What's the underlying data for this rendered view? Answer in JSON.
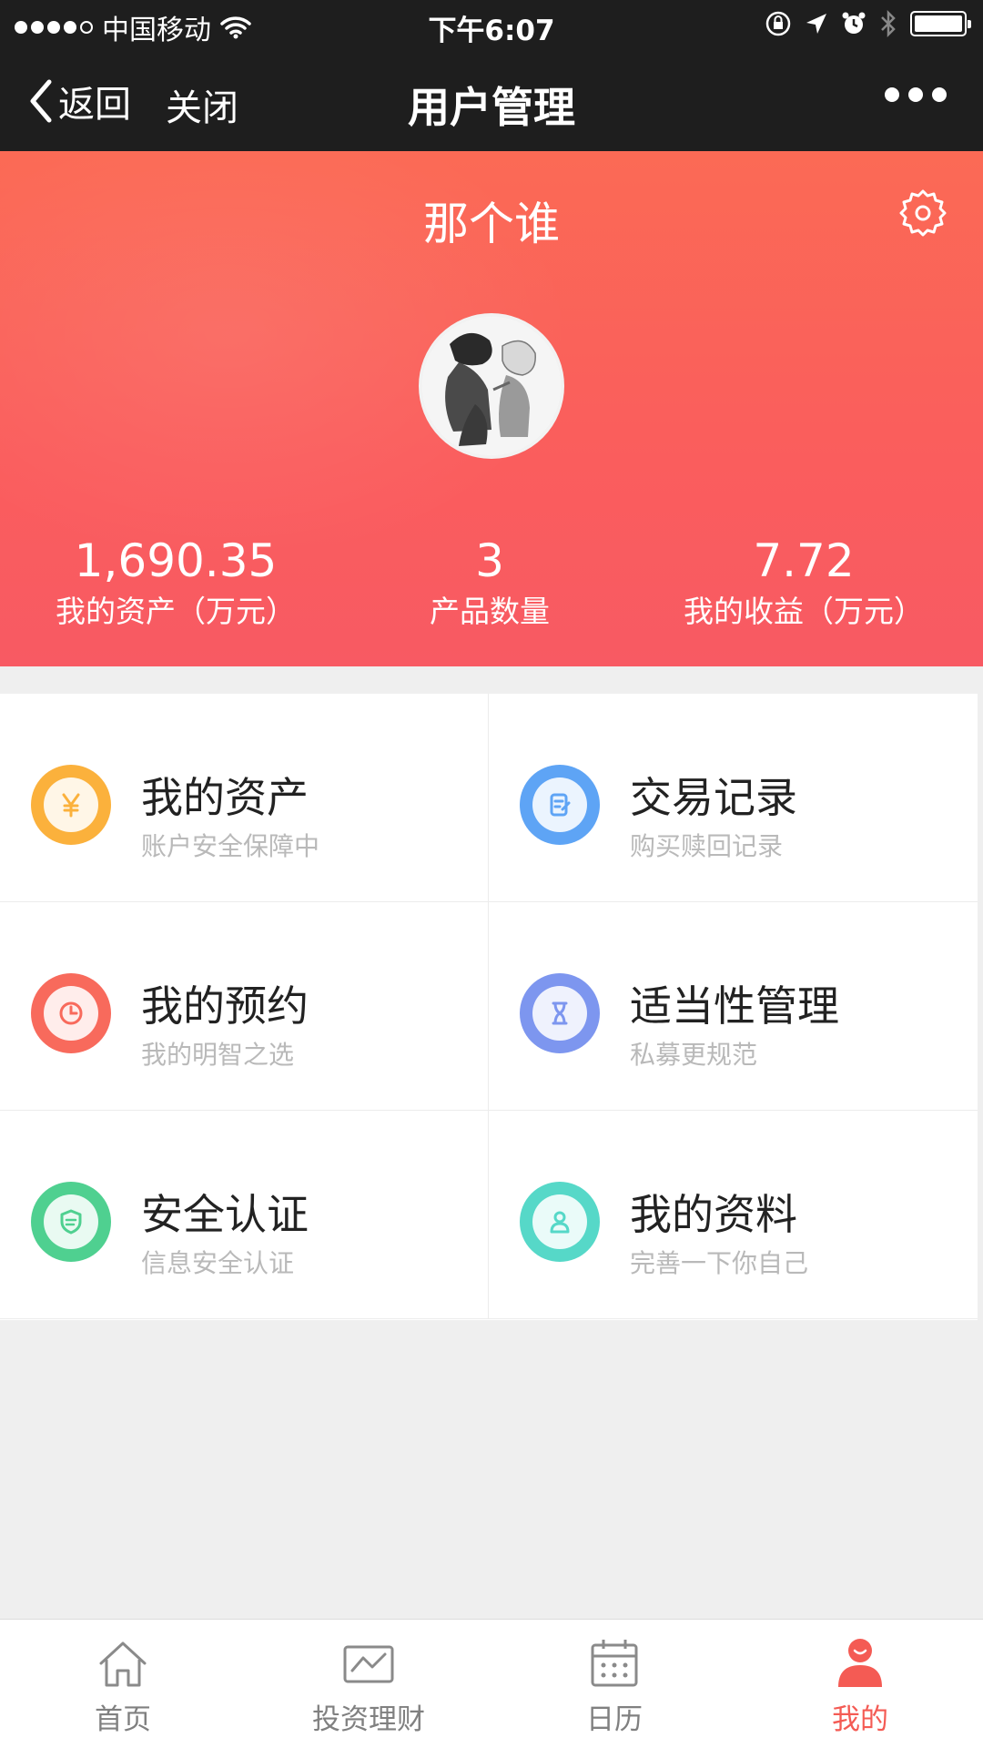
{
  "status_bar": {
    "carrier": "中国移动",
    "time": "下午6:07"
  },
  "nav": {
    "back_label": "返回",
    "close_label": "关闭",
    "title": "用户管理"
  },
  "profile": {
    "username": "那个谁",
    "stats": [
      {
        "value": "1,690.35",
        "label": "我的资产（万元）"
      },
      {
        "value": "3",
        "label": "产品数量"
      },
      {
        "value": "7.72",
        "label": "我的收益（万元）"
      }
    ]
  },
  "menu": [
    {
      "title": "我的资产",
      "subtitle": "账户安全保障中",
      "icon": "yen-icon",
      "color": "#fbb13c"
    },
    {
      "title": "交易记录",
      "subtitle": "购买赎回记录",
      "icon": "record-icon",
      "color": "#5ea4f5"
    },
    {
      "title": "我的预约",
      "subtitle": "我的明智之选",
      "icon": "clock-icon",
      "color": "#f86a5c"
    },
    {
      "title": "适当性管理",
      "subtitle": "私募更规范",
      "icon": "hourglass-icon",
      "color": "#7d96ef"
    },
    {
      "title": "安全认证",
      "subtitle": "信息安全认证",
      "icon": "shield-icon",
      "color": "#4fd090"
    },
    {
      "title": "我的资料",
      "subtitle": "完善一下你自己",
      "icon": "user-icon",
      "color": "#56d8c8"
    }
  ],
  "tabs": [
    {
      "label": "首页",
      "icon": "home-icon"
    },
    {
      "label": "投资理财",
      "icon": "chart-icon"
    },
    {
      "label": "日历",
      "icon": "calendar-icon"
    },
    {
      "label": "我的",
      "icon": "profile-icon"
    }
  ],
  "colors": {
    "nav_bg": "#1e1e1e",
    "header_gradient_top": "#fb6a55",
    "header_gradient_bottom": "#f85a63",
    "active_tab": "#f45b54",
    "inactive_tab": "#808080"
  }
}
